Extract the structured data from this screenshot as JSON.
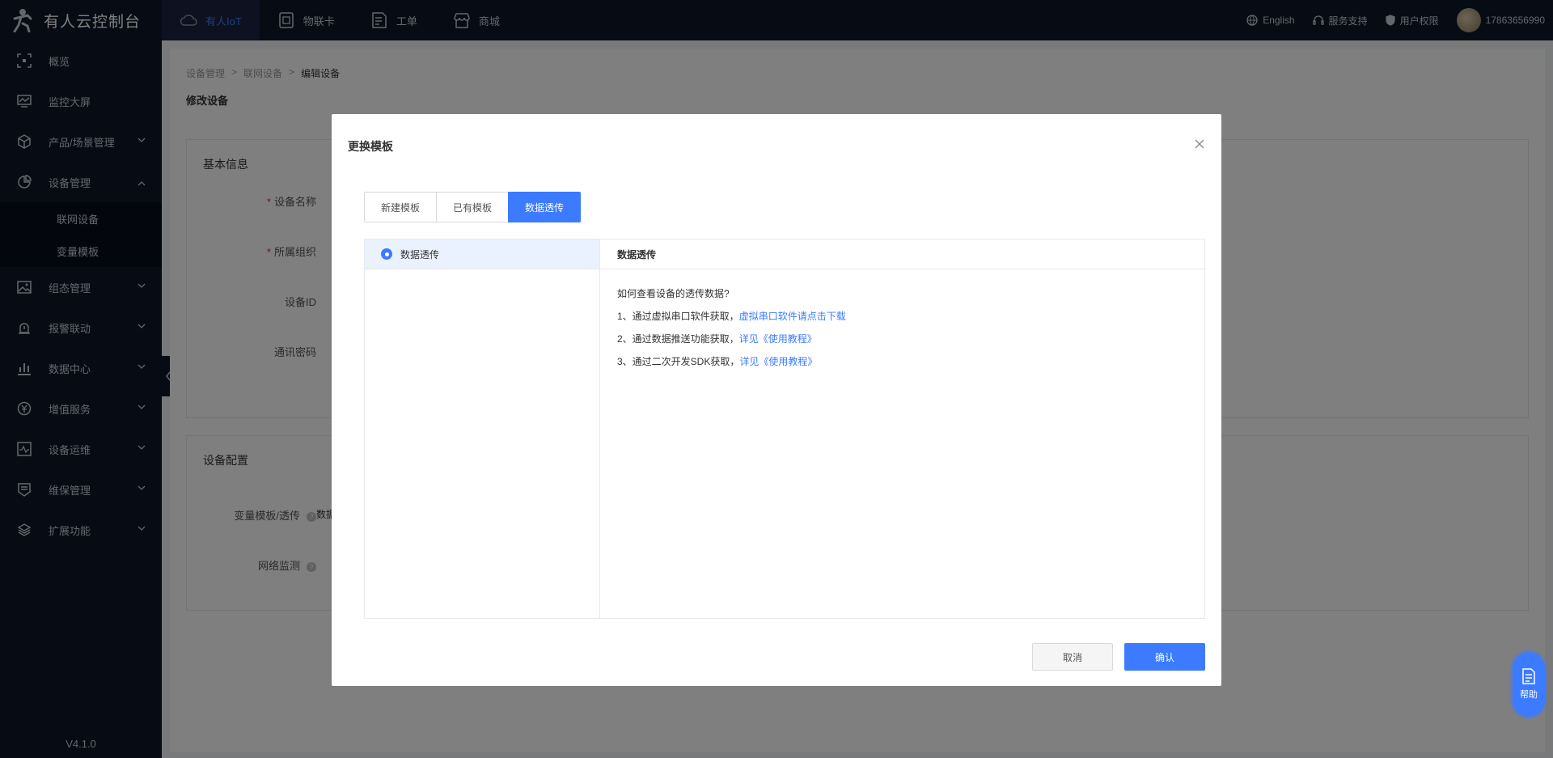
{
  "app": {
    "title": "有人云控制台",
    "version": "V4.1.0"
  },
  "topbar": {
    "tabs": [
      {
        "label": "有人IoT",
        "icon": "cloud-icon",
        "active": true
      },
      {
        "label": "物联卡",
        "icon": "sim-card-icon",
        "active": false
      },
      {
        "label": "工单",
        "icon": "ticket-icon",
        "active": false
      },
      {
        "label": "商城",
        "icon": "store-icon",
        "active": false
      }
    ],
    "language": "English",
    "support": "服务支持",
    "permissions": "用户权限",
    "user": "17863656990"
  },
  "sidebar": {
    "items": [
      {
        "label": "概览",
        "icon": "overview-icon"
      },
      {
        "label": "监控大屏",
        "icon": "monitor-icon"
      },
      {
        "label": "产品/场景管理",
        "icon": "box-icon"
      },
      {
        "label": "设备管理",
        "icon": "pie-chart-icon"
      },
      {
        "label": "组态管理",
        "icon": "image-icon"
      },
      {
        "label": "报警联动",
        "icon": "alarm-icon"
      },
      {
        "label": "数据中心",
        "icon": "bar-chart-icon"
      },
      {
        "label": "增值服务",
        "icon": "yen-icon"
      },
      {
        "label": "设备运维",
        "icon": "ops-icon"
      },
      {
        "label": "维保管理",
        "icon": "maintenance-icon"
      },
      {
        "label": "扩展功能",
        "icon": "layers-icon"
      }
    ],
    "sub_items": [
      "联网设备",
      "变量模板"
    ]
  },
  "main": {
    "breadcrumb": [
      "设备管理",
      "联网设备",
      "编辑设备"
    ],
    "page_title": "修改设备",
    "basic_card_title": "基本信息",
    "fields": {
      "device_name": "设备名称",
      "org": "所属组织",
      "device_id": "设备ID",
      "comm_password": "通讯密码"
    },
    "config_card_title": "设备配置",
    "config_fields": {
      "template": "变量模板/透传",
      "template_value": "数据",
      "network_monitor": "网络监测"
    }
  },
  "modal": {
    "title": "更换模板",
    "tabs": [
      {
        "label": "新建模板",
        "active": false
      },
      {
        "label": "已有模板",
        "active": false
      },
      {
        "label": "数据透传",
        "active": true
      }
    ],
    "left_item": "数据透传",
    "right_head": "数据透传",
    "question": "如何查看设备的透传数据?",
    "lines": [
      {
        "text": "1、通过虚拟串口软件获取，",
        "link": "虚拟串口软件请点击下载"
      },
      {
        "text": "2、通过数据推送功能获取，",
        "link": "详见《使用教程》"
      },
      {
        "text": "3、通过二次开发SDK获取，",
        "link": "详见《使用教程》"
      }
    ],
    "cancel": "取消",
    "confirm": "确认"
  },
  "help_button": "帮助",
  "colors": {
    "sidebar_bg": "#0f1629",
    "accent": "#3c7bff",
    "overlay": "rgba(0,0,0,0.5)"
  }
}
